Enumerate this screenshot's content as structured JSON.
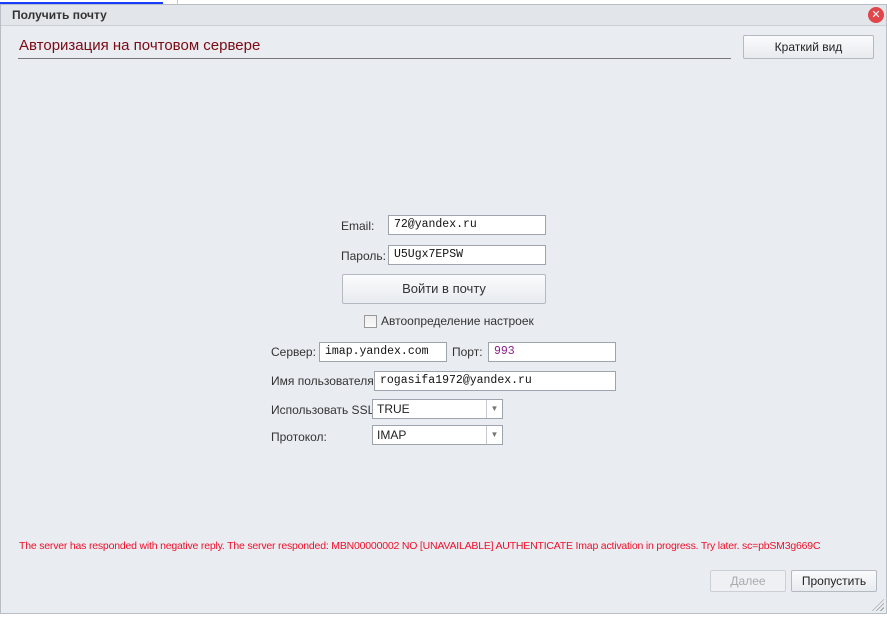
{
  "window": {
    "title": "Получить почту",
    "close_icon": "close-icon"
  },
  "heading": "Авторизация на почтовом сервере",
  "short_view_button": "Краткий вид",
  "form": {
    "email_label": "Email:",
    "email_value": "72@yandex.ru",
    "password_label": "Пароль:",
    "password_value": "U5Ugx7EPSW",
    "login_button": "Войти в почту",
    "autodetect_label": "Автоопределение настроек",
    "autodetect_checked": false,
    "server_label": "Сервер:",
    "server_value": "imap.yandex.com",
    "port_label": "Порт:",
    "port_value": "993",
    "username_label": "Имя пользователя:",
    "username_value": "rogasifa1972@yandex.ru",
    "ssl_label": "Использовать SSL:",
    "ssl_value": "TRUE",
    "protocol_label": "Протокол:",
    "protocol_value": "IMAP"
  },
  "error_message": "The server has responded with negative reply. The server responded: MBN00000002 NO [UNAVAILABLE] AUTHENTICATE Imap activation in progress. Try later. sc=pbSM3g669C",
  "footer": {
    "next_button": "Далее",
    "next_disabled": true,
    "skip_button": "Пропустить"
  },
  "colors": {
    "heading": "#7a0a14",
    "error": "#f0102a",
    "port_value": "#8b1a8b"
  }
}
